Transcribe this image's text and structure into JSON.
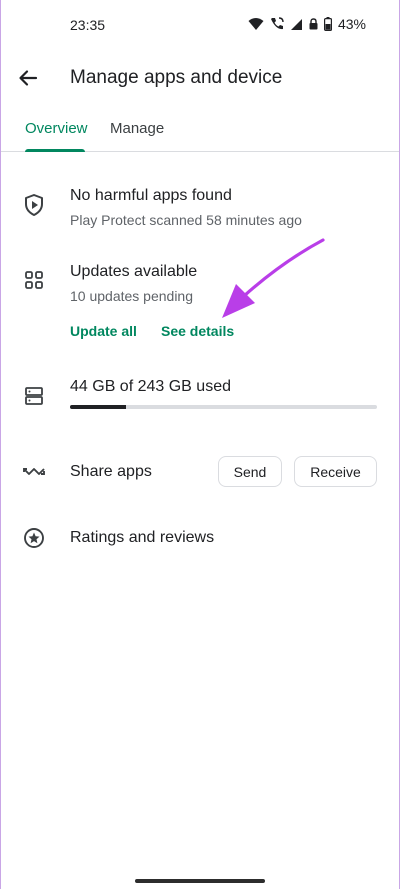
{
  "status_bar": {
    "time": "23:35",
    "battery": "43%",
    "icons": [
      "wifi-icon",
      "wifi-calling-icon",
      "signal-icon",
      "lock-icon",
      "battery-icon"
    ]
  },
  "app_bar": {
    "title": "Manage apps and device",
    "back_icon": "arrow-back-icon"
  },
  "tabs": [
    {
      "label": "Overview",
      "selected": true
    },
    {
      "label": "Manage",
      "selected": false
    }
  ],
  "play_protect": {
    "icon": "shield-play-icon",
    "title": "No harmful apps found",
    "subtitle": "Play Protect scanned 58 minutes ago"
  },
  "updates": {
    "icon": "apps-grid-icon",
    "title": "Updates available",
    "subtitle": "10 updates pending",
    "update_all_label": "Update all",
    "see_details_label": "See details"
  },
  "storage": {
    "icon": "storage-icon",
    "title": "44 GB of 243 GB used",
    "used_fraction": 0.181
  },
  "share": {
    "icon": "share-apps-icon",
    "title": "Share apps",
    "send_label": "Send",
    "receive_label": "Receive"
  },
  "ratings": {
    "icon": "star-circle-icon",
    "title": "Ratings and reviews"
  },
  "colors": {
    "accent": "#01875f",
    "annotation_arrow": "#b93ee8",
    "text_primary": "#202124",
    "text_secondary": "#5f6368"
  }
}
